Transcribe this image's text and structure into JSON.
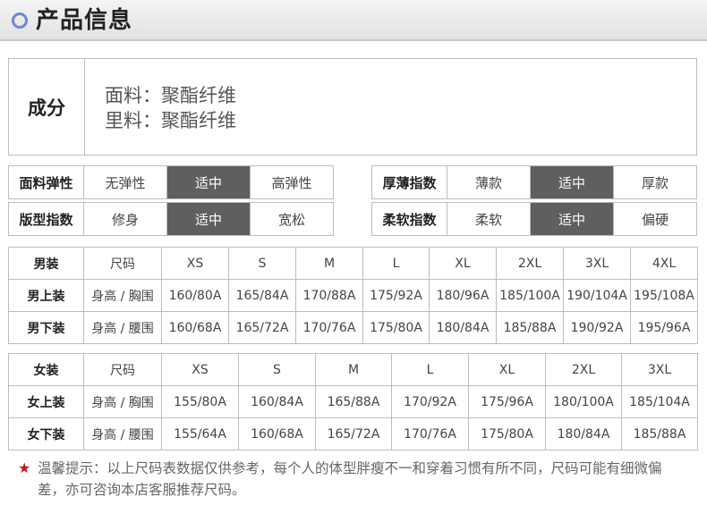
{
  "header": {
    "title": "产品信息"
  },
  "composition": {
    "label": "成分",
    "lines": [
      "面料：聚酯纤维",
      "里料：聚酯纤维"
    ]
  },
  "attributes": [
    {
      "label": "面料弹性",
      "options": [
        "无弹性",
        "适中",
        "高弹性"
      ],
      "selected": 1
    },
    {
      "label": "厚薄指数",
      "options": [
        "薄款",
        "适中",
        "厚款"
      ],
      "selected": 1
    },
    {
      "label": "版型指数",
      "options": [
        "修身",
        "适中",
        "宽松"
      ],
      "selected": 1
    },
    {
      "label": "柔软指数",
      "options": [
        "柔软",
        "适中",
        "偏硬"
      ],
      "selected": 1
    }
  ],
  "men_table": {
    "header": [
      "男装",
      "尺码",
      "XS",
      "S",
      "M",
      "L",
      "XL",
      "2XL",
      "3XL",
      "4XL"
    ],
    "rows": [
      [
        "男上装",
        "身高 / 胸围",
        "160/80A",
        "165/84A",
        "170/88A",
        "175/92A",
        "180/96A",
        "185/100A",
        "190/104A",
        "195/108A"
      ],
      [
        "男下装",
        "身高 / 腰围",
        "160/68A",
        "165/72A",
        "170/76A",
        "175/80A",
        "180/84A",
        "185/88A",
        "190/92A",
        "195/96A"
      ]
    ]
  },
  "women_table": {
    "header": [
      "女装",
      "尺码",
      "XS",
      "S",
      "M",
      "L",
      "XL",
      "2XL",
      "3XL"
    ],
    "rows": [
      [
        "女上装",
        "身高 / 胸围",
        "155/80A",
        "160/84A",
        "165/88A",
        "170/92A",
        "175/96A",
        "180/100A",
        "185/104A"
      ],
      [
        "女下装",
        "身高 / 腰围",
        "155/64A",
        "160/68A",
        "165/72A",
        "170/76A",
        "175/80A",
        "180/84A",
        "185/88A"
      ]
    ]
  },
  "note": {
    "icon": "star-icon",
    "text": "温馨提示：以上尺码表数据仅供参考，每个人的体型胖瘦不一和穿着习惯有所不同，尺码可能有细微偏差，亦可咨询本店客服推荐尺码。"
  },
  "colors": {
    "selected_bg": "#5f5f5f",
    "accent_ring": "#6f86d0",
    "star": "#c8161e"
  }
}
